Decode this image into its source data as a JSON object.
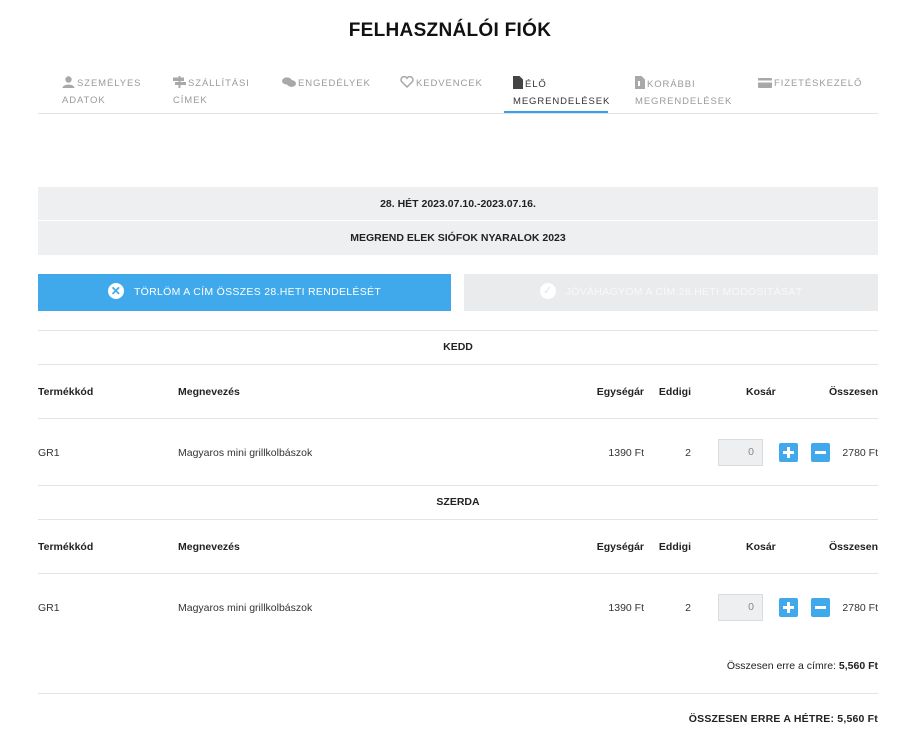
{
  "page": {
    "title": "FELHASZNÁLÓI FIÓK"
  },
  "tabs": [
    {
      "label_line1": "SZEMÉLYES",
      "label_line2": "ADATOK",
      "icon": "user-icon"
    },
    {
      "label_line1": "SZÁLLÍTÁSI",
      "label_line2": "CÍMEK",
      "icon": "signpost-icon"
    },
    {
      "label_line1": "ENGEDÉLYEK",
      "label_line2": "",
      "icon": "chat-icon"
    },
    {
      "label_line1": "KEDVENCEK",
      "label_line2": "",
      "icon": "heart-icon"
    },
    {
      "label_line1": "ÉLŐ",
      "label_line2": "MEGRENDELÉSEK",
      "icon": "document-icon",
      "active": true
    },
    {
      "label_line1": "KORÁBBI",
      "label_line2": "MEGRENDELÉSEK",
      "icon": "archive-document-icon"
    },
    {
      "label_line1": "FIZETÉSKEZELŐ",
      "label_line2": "",
      "icon": "credit-card-icon"
    }
  ],
  "week": {
    "title": "28. HÉT 2023.07.10.-2023.07.16.",
    "address": "MEGREND ELEK SIÓFOK NYARALOK 2023"
  },
  "actions": {
    "delete_label": "TÖRLÖM A CÍM ÖSSZES 28.HETI RENDELÉSÉT",
    "approve_label": "JÓVÁHAGYOM A CÍM 28.HETI MÓDOSÍTÁSÁT"
  },
  "columns": {
    "code": "Termékkód",
    "name": "Megnevezés",
    "unit_price": "Egységár",
    "so_far": "Eddigi",
    "cart": "Kosár",
    "total": "Összesen"
  },
  "days": [
    {
      "name": "KEDD",
      "rows": [
        {
          "code": "GR1",
          "name": "Magyaros mini grillkolbászok",
          "unit_price": "1390 Ft",
          "so_far": "2",
          "cart": "0",
          "total": "2780 Ft"
        }
      ]
    },
    {
      "name": "SZERDA",
      "rows": [
        {
          "code": "GR1",
          "name": "Magyaros mini grillkolbászok",
          "unit_price": "1390 Ft",
          "so_far": "2",
          "cart": "0",
          "total": "2780 Ft"
        }
      ]
    }
  ],
  "summary": {
    "address_label": "Összesen erre a címre:",
    "address_value": "5,560 Ft",
    "week_label": "ÖSSZESEN ERRE A HÉTRE:",
    "week_value": "5,560 Ft"
  },
  "colors": {
    "accent": "#3fa9ec",
    "tab_active_underline": "#3a9ee8",
    "panel_bg": "#eeeff0"
  }
}
